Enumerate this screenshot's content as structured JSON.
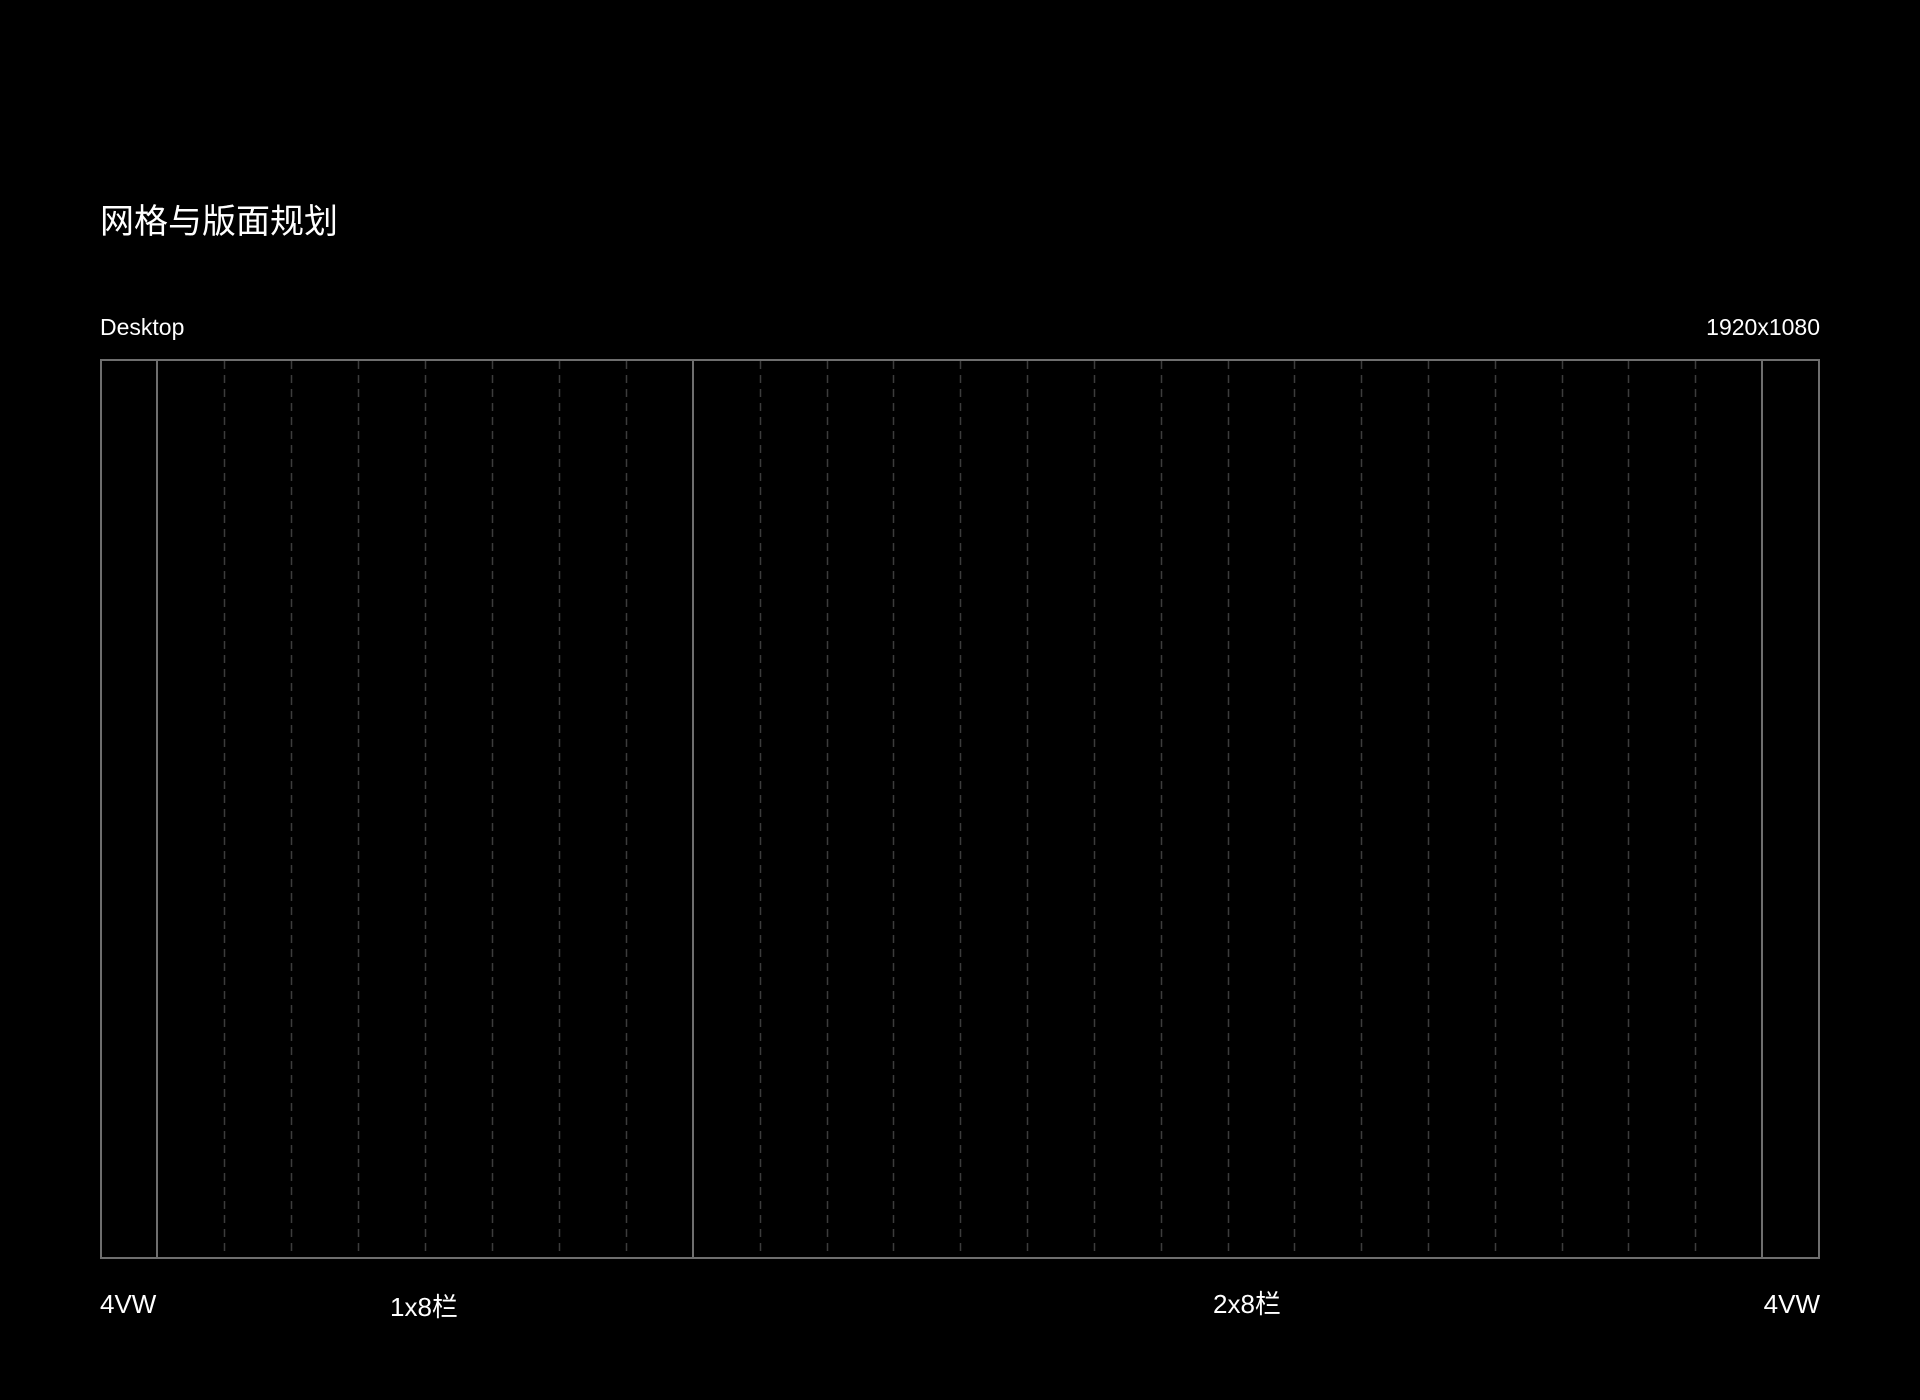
{
  "title": "网格与版面规划",
  "device": "Desktop",
  "resolution": "1920x1080",
  "grid": {
    "margin_label_left": "4VW",
    "margin_label_right": "4VW",
    "section_1_label": "1x8栏",
    "section_1_columns": 8,
    "section_2_label": "2x8栏",
    "section_2_columns": 16
  },
  "colors": {
    "background": "#000000",
    "text": "#ffffff",
    "frame_line": "#6e6e6e",
    "column_line": "#3c3c3c"
  }
}
